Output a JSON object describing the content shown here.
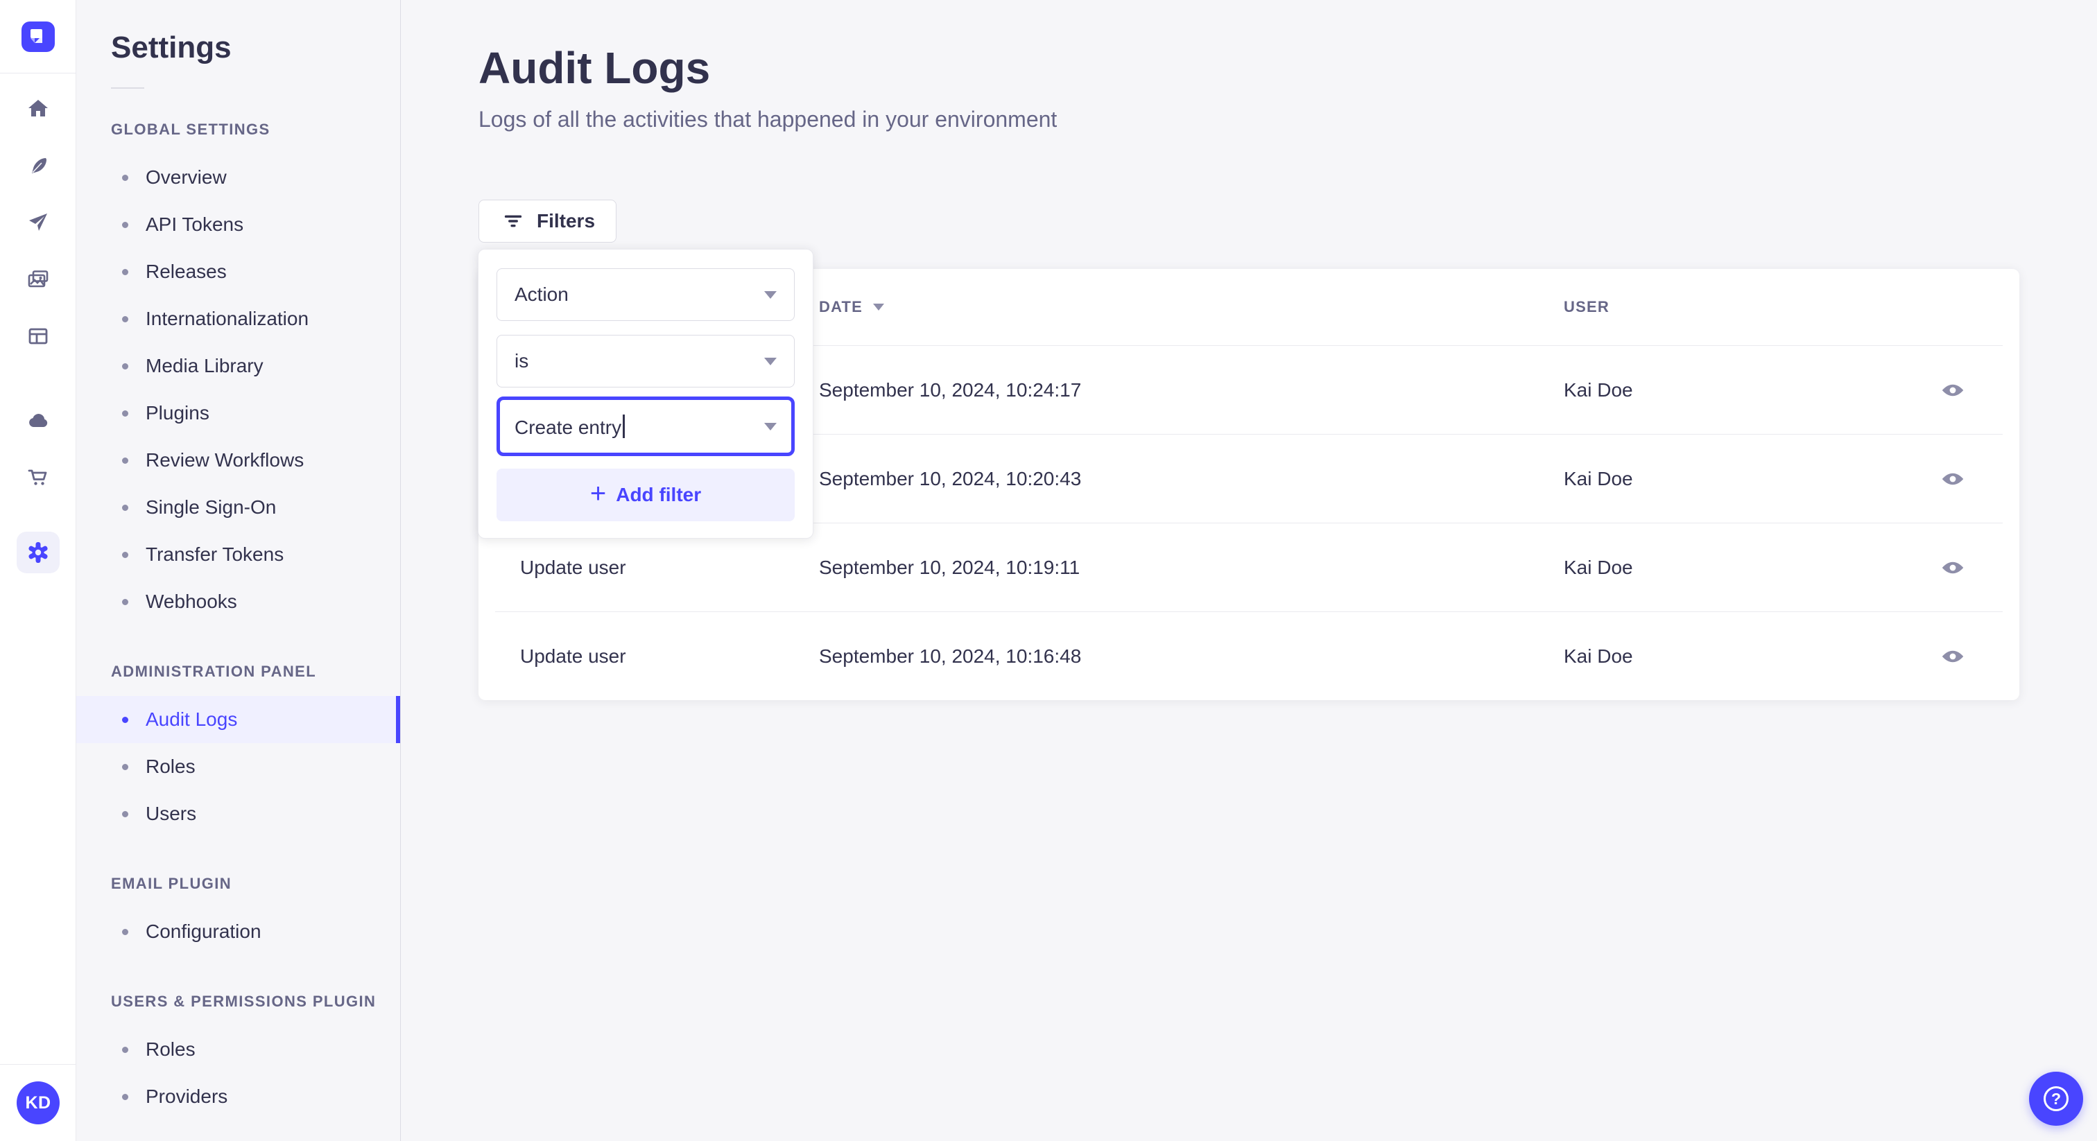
{
  "app": {
    "avatar_initials": "KD",
    "brand_color": "#4945ff"
  },
  "icon_rail": {
    "icons": [
      "strapi-logo-icon",
      "home-icon",
      "feather-icon",
      "paper-plane-icon",
      "photos-icon",
      "layout-icon",
      "cloud-icon",
      "cart-icon",
      "gear-icon"
    ],
    "active_icon": "gear-icon"
  },
  "sidebar": {
    "title": "Settings",
    "sections": [
      {
        "label": "GLOBAL SETTINGS",
        "items": [
          {
            "label": "Overview"
          },
          {
            "label": "API Tokens"
          },
          {
            "label": "Releases"
          },
          {
            "label": "Internationalization"
          },
          {
            "label": "Media Library"
          },
          {
            "label": "Plugins"
          },
          {
            "label": "Review Workflows"
          },
          {
            "label": "Single Sign-On"
          },
          {
            "label": "Transfer Tokens"
          },
          {
            "label": "Webhooks"
          }
        ]
      },
      {
        "label": "ADMINISTRATION PANEL",
        "items": [
          {
            "label": "Audit Logs",
            "active": true
          },
          {
            "label": "Roles"
          },
          {
            "label": "Users"
          }
        ]
      },
      {
        "label": "EMAIL PLUGIN",
        "items": [
          {
            "label": "Configuration"
          }
        ]
      },
      {
        "label": "USERS & PERMISSIONS PLUGIN",
        "items": [
          {
            "label": "Roles"
          },
          {
            "label": "Providers"
          }
        ]
      }
    ]
  },
  "main": {
    "title": "Audit Logs",
    "subtitle": "Logs of all the activities that happened in your environment",
    "filters_button_label": "Filters"
  },
  "filter_popover": {
    "field_select_value": "Action",
    "operator_select_value": "is",
    "value_input_value": "Create entry",
    "add_filter_label": "Add filter"
  },
  "table": {
    "columns": [
      {
        "label": "",
        "note": "hidden behind filter popover"
      },
      {
        "label": "DATE",
        "sorted": "desc"
      },
      {
        "label": "USER"
      }
    ],
    "rows": [
      {
        "action": "",
        "date": "September 10, 2024, 10:24:17",
        "user": "Kai Doe"
      },
      {
        "action": "",
        "date": "September 10, 2024, 10:20:43",
        "user": "Kai Doe"
      },
      {
        "action": "Update user",
        "date": "September 10, 2024, 10:19:11",
        "user": "Kai Doe"
      },
      {
        "action": "Update user",
        "date": "September 10, 2024, 10:16:48",
        "user": "Kai Doe"
      }
    ]
  },
  "colors": {
    "primary": "#4945ff",
    "primary_light": "#f0f0ff",
    "text": "#32324d",
    "text_muted": "#666687",
    "icon_muted": "#8e8ea9",
    "border": "#dcdce4",
    "background": "#f6f6f9",
    "card": "#ffffff"
  }
}
